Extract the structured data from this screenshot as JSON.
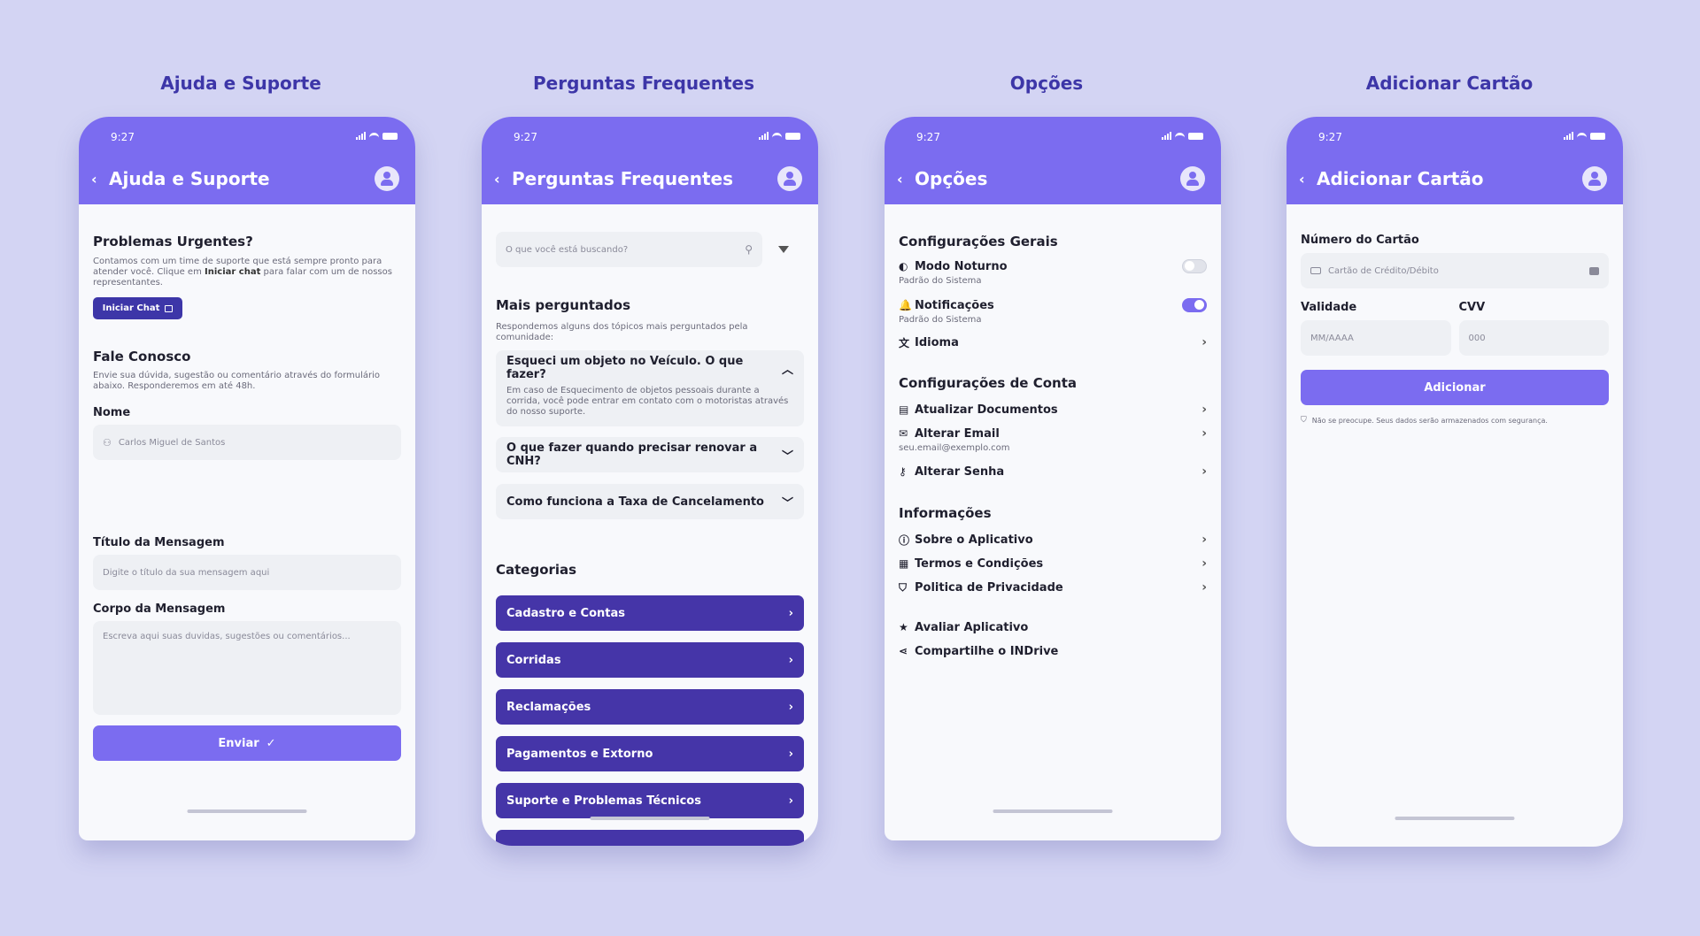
{
  "status_time": "9:27",
  "screens": {
    "support": {
      "title": "Ajuda e Suporte",
      "header_title": "Ajuda e Suporte",
      "urgent_heading": "Problemas Urgentes?",
      "urgent_text_1": "Contamos com um time de suporte que está sempre pronto para atender você. Clique em ",
      "urgent_text_bold": "Iniciar chat",
      "urgent_text_2": " para falar com um de nossos representantes.",
      "chat_button": "Iniciar Chat",
      "contact_heading": "Fale Conosco",
      "contact_text": "Envie sua dúvida, sugestão ou comentário através do formulário abaixo. Responderemos em até 48h.",
      "name_label": "Nome",
      "name_value": "Carlos Miguel de Santos",
      "msg_title_label": "Título da Mensagem",
      "msg_title_placeholder": "Digite o título da sua mensagem aqui",
      "msg_body_label": "Corpo da Mensagem",
      "msg_body_placeholder": "Escreva aqui suas duvidas, sugestões ou comentários...",
      "send_button": "Enviar"
    },
    "faq": {
      "title": "Perguntas Frequentes",
      "header_title": "Perguntas Frequentes",
      "search_placeholder": "O que você está buscando?",
      "most_asked_heading": "Mais perguntados",
      "most_asked_text": "Respondemos alguns dos tópicos mais perguntados pela comunidade:",
      "questions": [
        {
          "q": "Esqueci um objeto no Veículo. O que fazer?",
          "a": "Em caso de Esquecimento de objetos pessoais durante a corrida, você pode entrar em contato com o motoristas através do nosso suporte."
        },
        {
          "q": "O que fazer quando precisar renovar a CNH?"
        },
        {
          "q": "Como funciona a Taxa de Cancelamento"
        }
      ],
      "categories_heading": "Categorias",
      "categories": [
        "Cadastro e Contas",
        "Corridas",
        "Reclamações",
        "Pagamentos e Extorno",
        "Suporte e Problemas Técnicos"
      ]
    },
    "options": {
      "title": "Opções",
      "header_title": "Opções",
      "general_heading": "Configurações Gerais",
      "night_mode": "Modo Noturno",
      "night_mode_sub": "Padrão do Sistema",
      "notifications": "Notificações",
      "notifications_sub": "Padrão do Sistema",
      "language": "Idioma",
      "account_heading": "Configurações de Conta",
      "update_docs": "Atualizar Documentos",
      "change_email": "Alterar Email",
      "email_value": "seu.email@exemplo.com",
      "change_password": "Alterar Senha",
      "info_heading": "Informações",
      "about": "Sobre o Aplicativo",
      "terms": "Termos e Condições",
      "privacy": "Politica de Privacidade",
      "rate": "Avaliar Aplicativo",
      "share": "Compartilhe o INDrive"
    },
    "card": {
      "title": "Adicionar Cartão",
      "header_title": "Adicionar Cartão",
      "card_number_label": "Número do Cartão",
      "card_number_placeholder": "Cartão de Crédito/Débito",
      "validity_label": "Validade",
      "validity_placeholder": "MM/AAAA",
      "cvv_label": "CVV",
      "cvv_placeholder": "000",
      "add_button": "Adicionar",
      "security_note": "Não se preocupe. Seus dados serão armazenados com segurança."
    }
  },
  "toggles": {
    "night_mode": false,
    "notifications": true
  },
  "colors": {
    "background": "#d3d4f3",
    "accent": "#7b6cf0",
    "dark_accent": "#4535a8",
    "title": "#3d36a8"
  }
}
